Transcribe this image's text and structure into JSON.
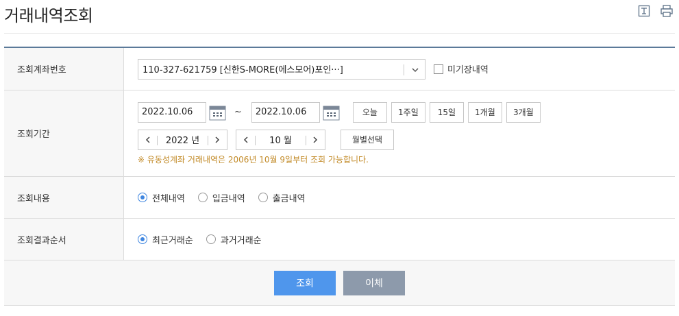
{
  "page": {
    "title": "거래내역조회",
    "icons": [
      "text-size-icon",
      "print-icon"
    ]
  },
  "account": {
    "label": "조회계좌번호",
    "selected": "110-327-621759 [신한S-MORE(에스모어)포인···]",
    "checkbox_label": "미기장내역",
    "checkbox_checked": false
  },
  "period": {
    "label": "조회기간",
    "start_date": "2022.10.06",
    "tilde": "~",
    "end_date": "2022.10.06",
    "quick_buttons": [
      "오늘",
      "1주일",
      "15일",
      "1개월",
      "3개월"
    ],
    "year_value": "2022 년",
    "month_value": "10 월",
    "month_select_label": "월별선택",
    "notice": "※ 유동성계좌 거래내역은 2006년 10월 9일부터 조회 가능합니다."
  },
  "content": {
    "label": "조회내용",
    "options": [
      "전체내역",
      "입금내역",
      "출금내역"
    ],
    "selected": "전체내역"
  },
  "order": {
    "label": "조회결과순서",
    "options": [
      "최근거래순",
      "과거거래순"
    ],
    "selected": "최근거래순"
  },
  "actions": {
    "search_label": "조회",
    "transfer_label": "이체"
  },
  "colors": {
    "header_rule": "#5b7a99",
    "notice": "#c28a27",
    "primary_button": "#4f96ec",
    "secondary_button": "#8d9aab",
    "radio_selected": "#3f86e0"
  }
}
